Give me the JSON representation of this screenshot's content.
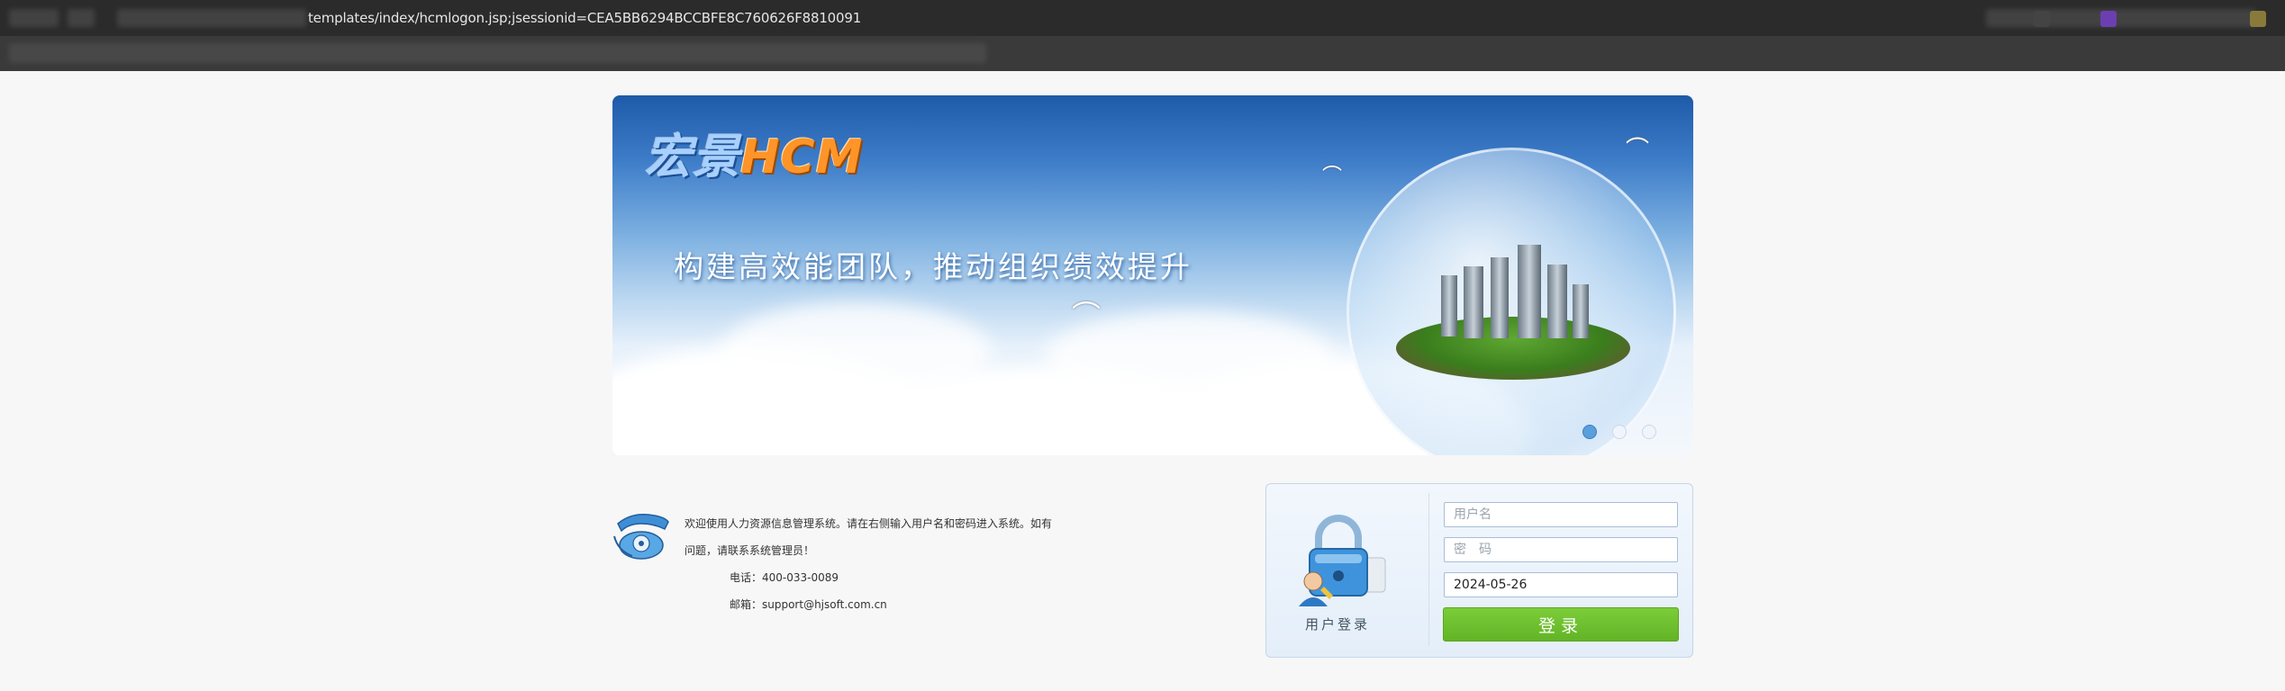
{
  "browser": {
    "url": "templates/index/hcmlogon.jsp;jsessionid=CEA5BB6294BCCBFE8C760626F8810091"
  },
  "banner": {
    "logo_cn": "宏景",
    "logo_en": "HCM",
    "slogan": "构建高效能团队，推动组织绩效提升",
    "carousel": {
      "slide_count": 3,
      "active_index": 0
    }
  },
  "contact": {
    "welcome_line1": "欢迎使用人力资源信息管理系统。请在右侧输入用户名和密码进入系统。如有",
    "welcome_line2": "问题，请联系系统管理员！",
    "phone": "电话：400-033-0089",
    "email": "邮箱：support@hjsoft.com.cn"
  },
  "login": {
    "label": "用户登录",
    "username_placeholder": "用户名",
    "password_placeholder": "密　码",
    "date_value": "2024-05-26",
    "submit_label": "登录"
  },
  "colors": {
    "login_button": "#6cbf2e",
    "logo_accent": "#ff9428",
    "banner_sky": "#3d7cc8"
  }
}
